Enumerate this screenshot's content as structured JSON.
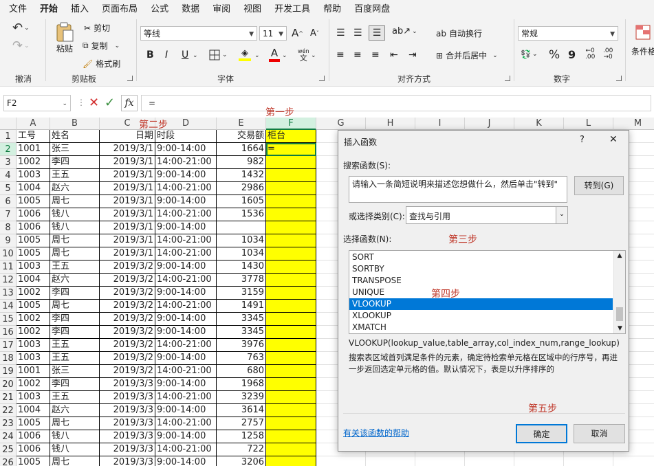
{
  "menu": [
    "文件",
    "开始",
    "插入",
    "页面布局",
    "公式",
    "数据",
    "审阅",
    "视图",
    "开发工具",
    "帮助",
    "百度网盘"
  ],
  "ribbon": {
    "undo_group": "撤消",
    "clipboard": {
      "paste": "粘贴",
      "cut": "剪切",
      "copy": "复制",
      "format": "格式刷",
      "label": "剪贴板"
    },
    "font": {
      "name": "等线",
      "size": "11",
      "bold": "B",
      "italic": "I",
      "underline": "U",
      "grow": "A",
      "shrink": "A",
      "wen": "wén",
      "label": "字体"
    },
    "align": {
      "wrap": "自动换行",
      "merge": "合并后居中",
      "label": "对齐方式"
    },
    "number": {
      "format": "常规",
      "percent": "%",
      "comma": "9",
      "dec_inc": ".00",
      "dec_dec": ".0",
      "label": "数字"
    },
    "cond_format": "条件格"
  },
  "formula_bar": {
    "name_box": "F2",
    "fx": "fx",
    "formula": "="
  },
  "columns": [
    "A",
    "B",
    "C",
    "D",
    "E",
    "F",
    "G",
    "H",
    "I",
    "J",
    "K",
    "L",
    "M"
  ],
  "headers": [
    "工号",
    "姓名",
    "日期",
    "时段",
    "交易额",
    "柜台"
  ],
  "rows": [
    [
      "1001",
      "张三",
      "2019/3/1",
      "9:00-14:00",
      "1664",
      "="
    ],
    [
      "1002",
      "李四",
      "2019/3/1",
      "14:00-21:00",
      "982",
      ""
    ],
    [
      "1003",
      "王五",
      "2019/3/1",
      "9:00-14:00",
      "1432",
      ""
    ],
    [
      "1004",
      "赵六",
      "2019/3/1",
      "14:00-21:00",
      "2986",
      ""
    ],
    [
      "1005",
      "周七",
      "2019/3/1",
      "9:00-14:00",
      "1605",
      ""
    ],
    [
      "1006",
      "钱八",
      "2019/3/1",
      "14:00-21:00",
      "1536",
      ""
    ],
    [
      "1006",
      "钱八",
      "2019/3/1",
      "9:00-14:00",
      "",
      ""
    ],
    [
      "1005",
      "周七",
      "2019/3/1",
      "14:00-21:00",
      "1034",
      ""
    ],
    [
      "1005",
      "周七",
      "2019/3/1",
      "14:00-21:00",
      "1034",
      ""
    ],
    [
      "1003",
      "王五",
      "2019/3/2",
      "9:00-14:00",
      "1430",
      ""
    ],
    [
      "1004",
      "赵六",
      "2019/3/2",
      "14:00-21:00",
      "3778",
      ""
    ],
    [
      "1002",
      "李四",
      "2019/3/2",
      "9:00-14:00",
      "3159",
      ""
    ],
    [
      "1005",
      "周七",
      "2019/3/2",
      "14:00-21:00",
      "1491",
      ""
    ],
    [
      "1002",
      "李四",
      "2019/3/2",
      "9:00-14:00",
      "3345",
      ""
    ],
    [
      "1002",
      "李四",
      "2019/3/2",
      "9:00-14:00",
      "3345",
      ""
    ],
    [
      "1003",
      "王五",
      "2019/3/2",
      "14:00-21:00",
      "3976",
      ""
    ],
    [
      "1003",
      "王五",
      "2019/3/2",
      "9:00-14:00",
      "763",
      ""
    ],
    [
      "1001",
      "张三",
      "2019/3/2",
      "14:00-21:00",
      "680",
      ""
    ],
    [
      "1002",
      "李四",
      "2019/3/3",
      "9:00-14:00",
      "1968",
      ""
    ],
    [
      "1003",
      "王五",
      "2019/3/3",
      "14:00-21:00",
      "3239",
      ""
    ],
    [
      "1004",
      "赵六",
      "2019/3/3",
      "9:00-14:00",
      "3614",
      ""
    ],
    [
      "1005",
      "周七",
      "2019/3/3",
      "14:00-21:00",
      "2757",
      ""
    ],
    [
      "1006",
      "钱八",
      "2019/3/3",
      "9:00-14:00",
      "1258",
      ""
    ],
    [
      "1006",
      "钱八",
      "2019/3/3",
      "14:00-21:00",
      "722",
      ""
    ],
    [
      "1005",
      "周七",
      "2019/3/3",
      "9:00-14:00",
      "3206",
      ""
    ]
  ],
  "annotations": {
    "step1": "第一步",
    "step2": "第二步",
    "step3": "第三步",
    "step4": "第四步",
    "step5": "第五步"
  },
  "dialog": {
    "title": "插入函数",
    "help": "?",
    "close": "✕",
    "search_label": "搜索函数(S):",
    "search_text": "请输入一条简短说明来描述您想做什么，然后单击\"转到\"",
    "go_button": "转到(G)",
    "category_label": "或选择类别(C):",
    "category_value": "查找与引用",
    "function_label": "选择函数(N):",
    "functions": [
      "SORT",
      "SORTBY",
      "TRANSPOSE",
      "UNIQUE",
      "VLOOKUP",
      "XLOOKUP",
      "XMATCH"
    ],
    "selected": "VLOOKUP",
    "signature": "VLOOKUP(lookup_value,table_array,col_index_num,range_lookup)",
    "description": "搜索表区域首列满足条件的元素，确定待检索单元格在区域中的行序号，再进一步返回选定单元格的值。默认情况下，表是以升序排序的",
    "help_link": "有关该函数的帮助",
    "ok": "确定",
    "cancel": "取消"
  },
  "colors": {
    "accent": "#107c41",
    "highlight": "#ffff00",
    "selection": "#0078d7",
    "annotation": "#c0392b"
  }
}
